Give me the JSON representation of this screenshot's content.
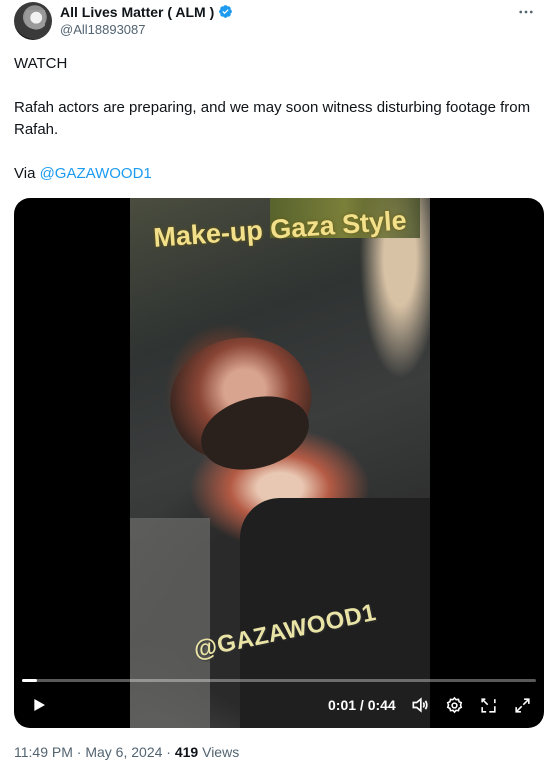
{
  "author": {
    "display_name": "All Lives Matter ( ALM )",
    "handle": "@All18893087",
    "verified": true
  },
  "tweet": {
    "line1": "WATCH",
    "line2": "Rafah actors are preparing, and we may soon witness disturbing footage from Rafah.",
    "via_prefix": "Via ",
    "via_mention": "@GAZAWOOD1"
  },
  "video": {
    "caption_overlay": "Make-up Gaza Style",
    "watermark_overlay": "@GAZAWOOD1",
    "time_display": "0:01 / 0:44",
    "progress": 0.03
  },
  "meta": {
    "time": "11:49 PM",
    "separator1": " · ",
    "date": "May 6, 2024",
    "separator2": " · ",
    "views_count": "419",
    "views_label": " Views"
  },
  "colors": {
    "accent": "#1d9bf0",
    "text": "#0f1419",
    "secondary": "#536471"
  },
  "icons": [
    "more-icon",
    "verified-badge-icon",
    "play-icon",
    "volume-icon",
    "settings-icon",
    "mini-player-icon",
    "fullscreen-icon"
  ]
}
